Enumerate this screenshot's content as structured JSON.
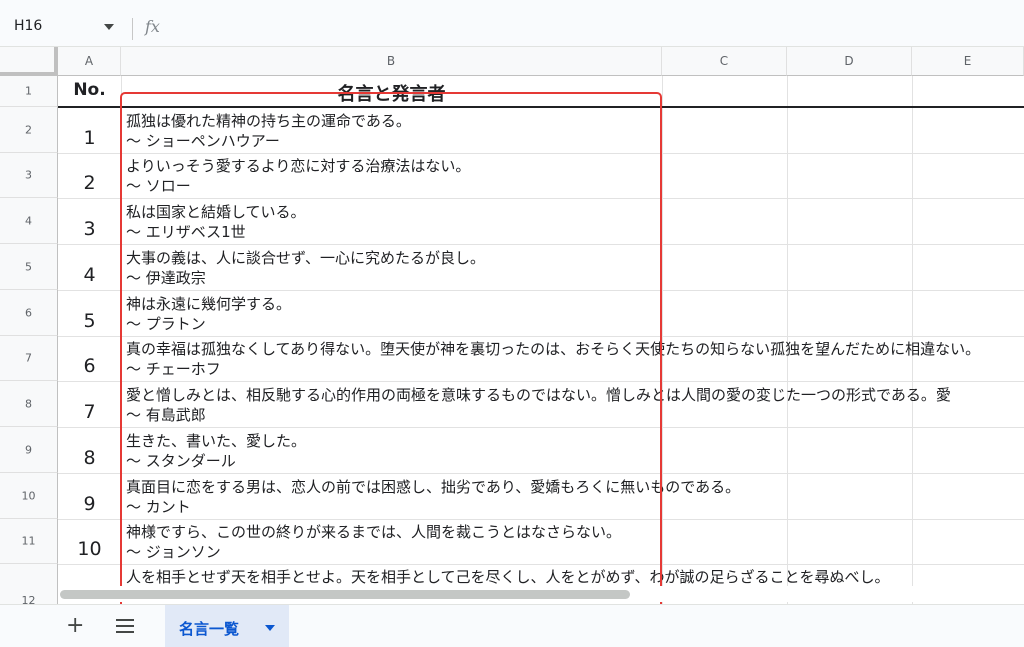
{
  "formula_bar": {
    "cell_reference": "H16",
    "fx_icon": "fx-icon",
    "dropdown_icon": "chevron-down-icon"
  },
  "columns": [
    "A",
    "B",
    "C",
    "D",
    "E"
  ],
  "header_row": {
    "row_number": "1",
    "no": "No.",
    "quote_and_speaker": "名言と発言者"
  },
  "rows": [
    {
      "row_number": "2",
      "no": "1",
      "quote": "孤独は優れた精神の持ち主の運命である。",
      "speaker": "〜 ショーペンハウアー"
    },
    {
      "row_number": "3",
      "no": "2",
      "quote": "よりいっそう愛するより恋に対する治療法はない。",
      "speaker": "〜 ソロー"
    },
    {
      "row_number": "4",
      "no": "3",
      "quote": "私は国家と結婚している。",
      "speaker": "〜 エリザベス1世"
    },
    {
      "row_number": "5",
      "no": "4",
      "quote": "大事の義は、人に談合せず、一心に究めたるが良し。",
      "speaker": "〜 伊達政宗"
    },
    {
      "row_number": "6",
      "no": "5",
      "quote": "神は永遠に幾何学する。",
      "speaker": "〜 プラトン"
    },
    {
      "row_number": "7",
      "no": "6",
      "quote": "真の幸福は孤独なくしてあり得ない。堕天使が神を裏切ったのは、おそらく天使たちの知らない孤独を望んだために相違ない。",
      "speaker": "〜 チェーホフ"
    },
    {
      "row_number": "8",
      "no": "7",
      "quote": "愛と憎しみとは、相反馳する心的作用の両極を意味するものではない。憎しみとは人間の愛の変じた一つの形式である。愛",
      "speaker": "〜 有島武郎"
    },
    {
      "row_number": "9",
      "no": "8",
      "quote": "生きた、書いた、愛した。",
      "speaker": "〜 スタンダール"
    },
    {
      "row_number": "10",
      "no": "9",
      "quote": "真面目に恋をする男は、恋人の前では困惑し、拙劣であり、愛嬌もろくに無いものである。",
      "speaker": "〜 カント"
    },
    {
      "row_number": "11",
      "no": "10",
      "quote": "神様ですら、この世の終りが来るまでは、人間を裁こうとはなさらない。",
      "speaker": "〜 ジョンソン"
    },
    {
      "row_number": "12",
      "no": "",
      "quote": "人を相手とせず天を相手とせよ。天を相手として己を尽くし、人をとがめず、わが誠の足らざることを尋ぬべし。",
      "speaker": ""
    }
  ],
  "sheet_bar": {
    "add_icon": "plus-icon",
    "menu_icon": "hamburger-menu-icon",
    "active_tab": "名言一覧"
  },
  "colors": {
    "highlight": "#e53935",
    "tab_active_bg": "#e1e9f7",
    "tab_active_text": "#0b57d0"
  }
}
